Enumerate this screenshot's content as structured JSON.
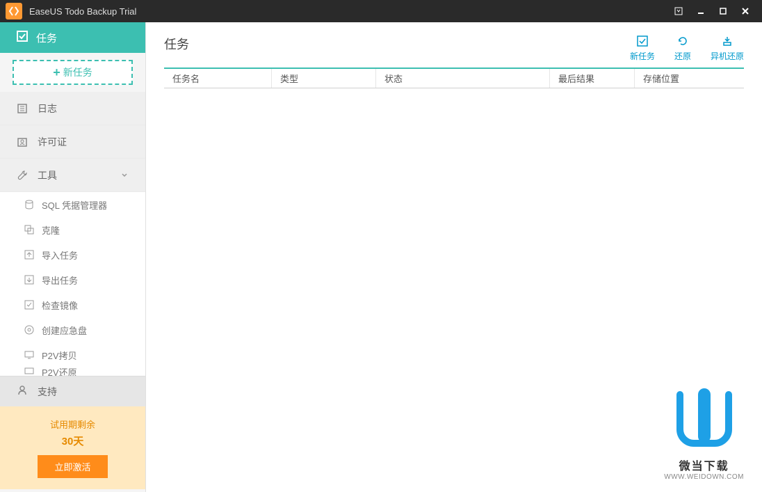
{
  "titlebar": {
    "title": "EaseUS Todo Backup Trial"
  },
  "sidebar": {
    "tasks_label": "任务",
    "new_task_label": "新任务",
    "log_label": "日志",
    "license_label": "许可证",
    "tools_label": "工具",
    "tools": [
      {
        "label": "SQL 凭据管理器"
      },
      {
        "label": "克隆"
      },
      {
        "label": "导入任务"
      },
      {
        "label": "导出任务"
      },
      {
        "label": "检查镜像"
      },
      {
        "label": "创建应急盘"
      },
      {
        "label": "P2V拷贝"
      },
      {
        "label": "P2V还原"
      }
    ],
    "support_label": "支持"
  },
  "trial": {
    "label": "试用期剩余",
    "days": "30天",
    "activate": "立即激活"
  },
  "content": {
    "title": "任务",
    "actions": {
      "new_task": "新任务",
      "restore": "还原",
      "system_restore": "异机还原"
    },
    "columns": {
      "name": "任务名",
      "type": "类型",
      "status": "状态",
      "result": "最后结果",
      "location": "存储位置"
    }
  },
  "watermark": {
    "text": "微当下载",
    "url": "WWW.WEIDOWN.COM"
  }
}
